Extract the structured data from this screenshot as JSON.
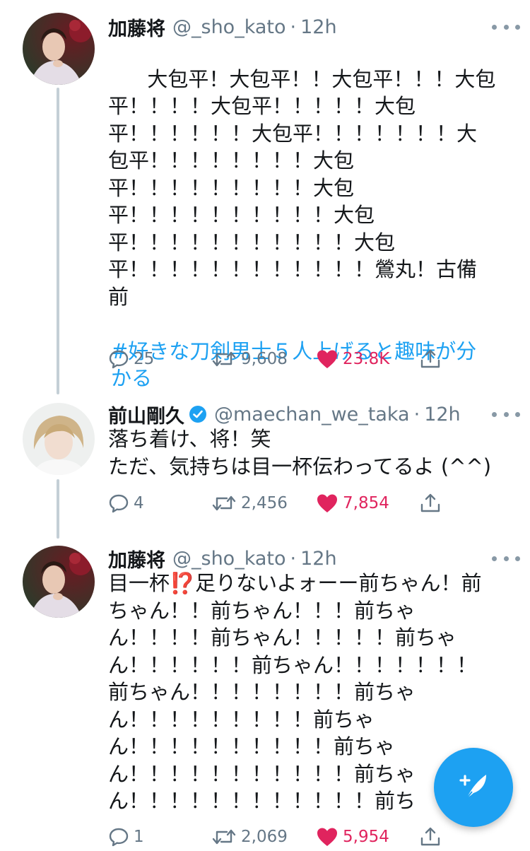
{
  "colors": {
    "accent": "#1da1f2",
    "like": "#e0245e",
    "muted": "#657786",
    "thread_line": "#c4cfd6"
  },
  "tweets": [
    {
      "name": "加藤将",
      "handle": "@_sho_kato",
      "dot": "·",
      "time": "12h",
      "verified": false,
      "text": "大包平！大包平！！大包平！！！大包\n平！！！！大包平！！！！！大包\n平！！！！！！大包平！！！！！！！大\n包平！！！！！！！！大包\n平！！！！！！！！！大包\n平！！！！！！！！！！大包\n平！！！！！！！！！！！大包\n平！！！！！！！！！！！！鶯丸！古備\n前",
      "hashtag": "#好きな刀剣男士５人上げると趣味が分\nかる",
      "replies": "25",
      "retweets": "9,608",
      "likes": "23.8K",
      "icons": [
        "reply-icon",
        "retweet-icon",
        "heart-icon",
        "share-icon"
      ]
    },
    {
      "name": "前山剛久",
      "handle": "@maechan_we_taka",
      "dot": "·",
      "time": "12h",
      "verified": true,
      "text": "落ち着け、将！笑\nただ、気持ちは目一杯伝わってるよ (^^)",
      "replies": "4",
      "retweets": "2,456",
      "likes": "7,854"
    },
    {
      "name": "加藤将",
      "handle": "@_sho_kato",
      "dot": "·",
      "time": "12h",
      "verified": false,
      "text_before_emoji": "目一杯",
      "emoji": "⁉️",
      "text": "足りないよォーー前ちゃん！前\nちゃん！！前ちゃん！！！前ちゃ\nん！！！！前ちゃん！！！！！前ちゃ\nん！！！！！！前ちゃん！！！！！！！\n前ちゃん！！！！！！！！前ちゃ\nん！！！！！！！！！前ちゃ\nん！！！！！！！！！！前ちゃ\nん！！！！！！！！！！！前ちゃ\nん！！！！！！！！！！！！前ち",
      "replies": "1",
      "retweets": "2,069",
      "likes": "5,954"
    }
  ],
  "fab": {
    "icon": "compose-tweet-icon"
  }
}
